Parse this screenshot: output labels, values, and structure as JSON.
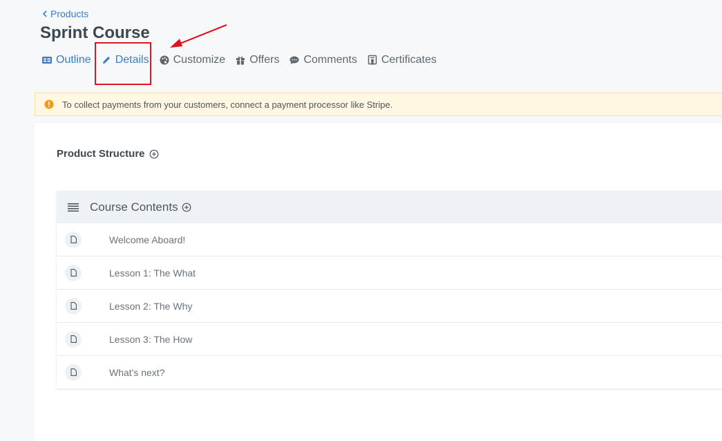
{
  "breadcrumb": {
    "back_label": "Products"
  },
  "page": {
    "title": "Sprint Course"
  },
  "tabs": [
    {
      "label": "Outline",
      "icon": "outline-icon",
      "active": true
    },
    {
      "label": "Details",
      "icon": "pencil-icon"
    },
    {
      "label": "Customize",
      "icon": "palette-icon"
    },
    {
      "label": "Offers",
      "icon": "gift-icon"
    },
    {
      "label": "Comments",
      "icon": "comment-icon"
    },
    {
      "label": "Certificates",
      "icon": "certificate-icon"
    }
  ],
  "alert": {
    "icon": "warning-icon",
    "text": "To collect payments from your customers, connect a payment processor like Stripe."
  },
  "structure": {
    "title": "Product Structure",
    "contents_title": "Course Contents",
    "items": [
      {
        "label": "Welcome Aboard!"
      },
      {
        "label": "Lesson 1: The What"
      },
      {
        "label": "Lesson 2: The Why"
      },
      {
        "label": "Lesson 3: The How"
      },
      {
        "label": "What's next?"
      }
    ]
  },
  "colors": {
    "accent": "#3b7cc4",
    "annotation": "#e0141e",
    "alert_bg": "#fef8e3",
    "warning": "#f39c12"
  }
}
